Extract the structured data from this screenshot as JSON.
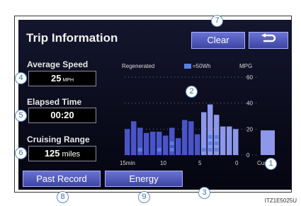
{
  "header": {
    "title": "Trip Information",
    "clear_label": "Clear",
    "back_icon": "return-arrow-icon"
  },
  "metrics": {
    "avg_speed": {
      "label": "Average Speed",
      "value": "25",
      "unit": "MPH"
    },
    "elapsed": {
      "label": "Elapsed Time",
      "value": "00:20"
    },
    "range": {
      "label": "Cruising Range",
      "value": "125",
      "unit": "miles"
    }
  },
  "chart": {
    "regenerated_label": "Regenerated",
    "legend_text": "=50Wh",
    "mpg_label": "MPG",
    "y_ticks": [
      "60",
      "40",
      "20",
      "0"
    ],
    "x_ticks": [
      "15min",
      "10",
      "5",
      "0"
    ],
    "current_label": "Current"
  },
  "chart_data": {
    "type": "bar",
    "x": [
      "15min",
      "10",
      "5",
      "0"
    ],
    "ylabel": "MPG",
    "ylim": [
      0,
      60
    ],
    "values": [
      20,
      26,
      21,
      17,
      18,
      18,
      15,
      21,
      13,
      27,
      26,
      16,
      33,
      39,
      31,
      22,
      22,
      20
    ],
    "regenerated": [
      0,
      0,
      1,
      0,
      0,
      1,
      0,
      2,
      0,
      0,
      0,
      0,
      1,
      3,
      3,
      0,
      0,
      0
    ],
    "current": 19
  },
  "bottom": {
    "past_record_label": "Past Record",
    "energy_label": "Energy"
  },
  "callouts": [
    "1",
    "2",
    "3",
    "4",
    "5",
    "6",
    "7",
    "8",
    "9"
  ],
  "footer": "ITZ1E5025U",
  "colors": {
    "bar": "#4a54c8",
    "bar_recent": "#8d98ea",
    "regen": "#5a7ee8",
    "button": "#4a52b8"
  }
}
